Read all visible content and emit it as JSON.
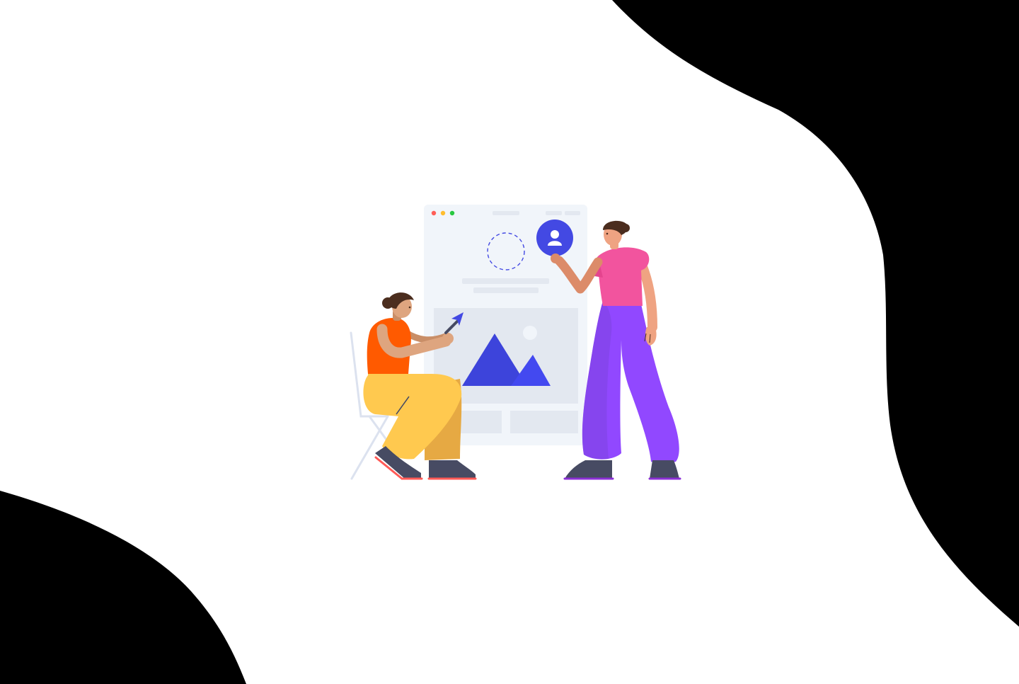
{
  "scene": {
    "background_color": "#ffffff",
    "blob_color": "#000000",
    "illustration": "web-design-collaboration",
    "palette": {
      "mockup_bg": "#f1f5fa",
      "mockup_block": "#e3e8f0",
      "accent_blue": "#4349e3",
      "mountain_blue": "#3d44db",
      "window_dot_red": "#ff5e57",
      "window_dot_yellow": "#ffbd2e",
      "window_dot_green": "#28c840",
      "seated_top": "#ff5a00",
      "seated_pants": "#ffc94f",
      "standing_top": "#f2549e",
      "standing_pants": "#9148ff",
      "shoes": "#474b63",
      "skin_light": "#dea57f",
      "skin_tan": "#c98e67",
      "hair": "#4b2d1e"
    },
    "icons": [
      "user-avatar-icon",
      "image-placeholder-icon",
      "cursor-arrow-icon"
    ]
  }
}
